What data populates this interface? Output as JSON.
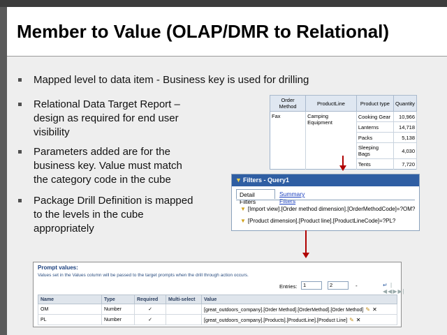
{
  "slide": {
    "title": "Member to Value  (OLAP/DMR to Relational)"
  },
  "bullets": {
    "b1": "Mapped level to data item - Business key is used for drilling",
    "b2_l1": "Relational Data Target Report –",
    "b2_l2": "design as required for end user",
    "b2_l3": "visibility",
    "b3_l1": "Parameters added are for the",
    "b3_l2": "business key. Value must match",
    "b3_l3": "the category code in the cube",
    "b4_l1": "Package Drill Definition is mapped",
    "b4_l2": "to the levels in the cube",
    "b4_l3": "appropriately"
  },
  "report_table": {
    "headers": [
      "Order Method",
      "ProductLine",
      "Product type",
      "Quantity"
    ],
    "order_method": "Fax",
    "product_line": "Camping Equipment",
    "rows": [
      {
        "type": "Cooking Gear",
        "qty": "10,966"
      },
      {
        "type": "Lanterns",
        "qty": "14,718"
      },
      {
        "type": "Packs",
        "qty": "5,138"
      },
      {
        "type": "Sleeping Bags",
        "qty": "4,030"
      },
      {
        "type": "Tents",
        "qty": "7,720"
      }
    ]
  },
  "filters": {
    "title": "Filters - Query1",
    "tab_detail": "Detail Filters",
    "tab_summary": "Summary Filters",
    "row1": "[Import view].[Order method dimension].[OrderMethodCode]=?OM?",
    "row2": "[Product dimension].[Product line].[ProductLineCode]=?PL?"
  },
  "prompt_values": {
    "title": "Prompt values:",
    "description": "Values set in the Values column will be passed to the target prompts when the drill through action occurs.",
    "entries_label": "Entries:",
    "entries_from": "1",
    "entries_to": "2",
    "headers": [
      "Name",
      "Type",
      "Required",
      "Multi-select",
      "Value"
    ],
    "rows": [
      {
        "name": "OM",
        "type": "Number",
        "required": "✓",
        "multi": "",
        "value": "[great_outdoors_company].[Order Method].[OrderMethod].[Order Method]"
      },
      {
        "name": "PL",
        "type": "Number",
        "required": "✓",
        "multi": "",
        "value": "[great_outdoors_company].[Products].[ProductLine].[Product Line]"
      }
    ]
  },
  "colors": {
    "arrow": "#b00000",
    "filters_header": "#2f5ea3"
  },
  "icons": [
    "filter-icon",
    "pencil-icon",
    "delete-icon",
    "first-page-icon",
    "prev-page-icon",
    "next-page-icon",
    "last-page-icon",
    "go-icon"
  ]
}
